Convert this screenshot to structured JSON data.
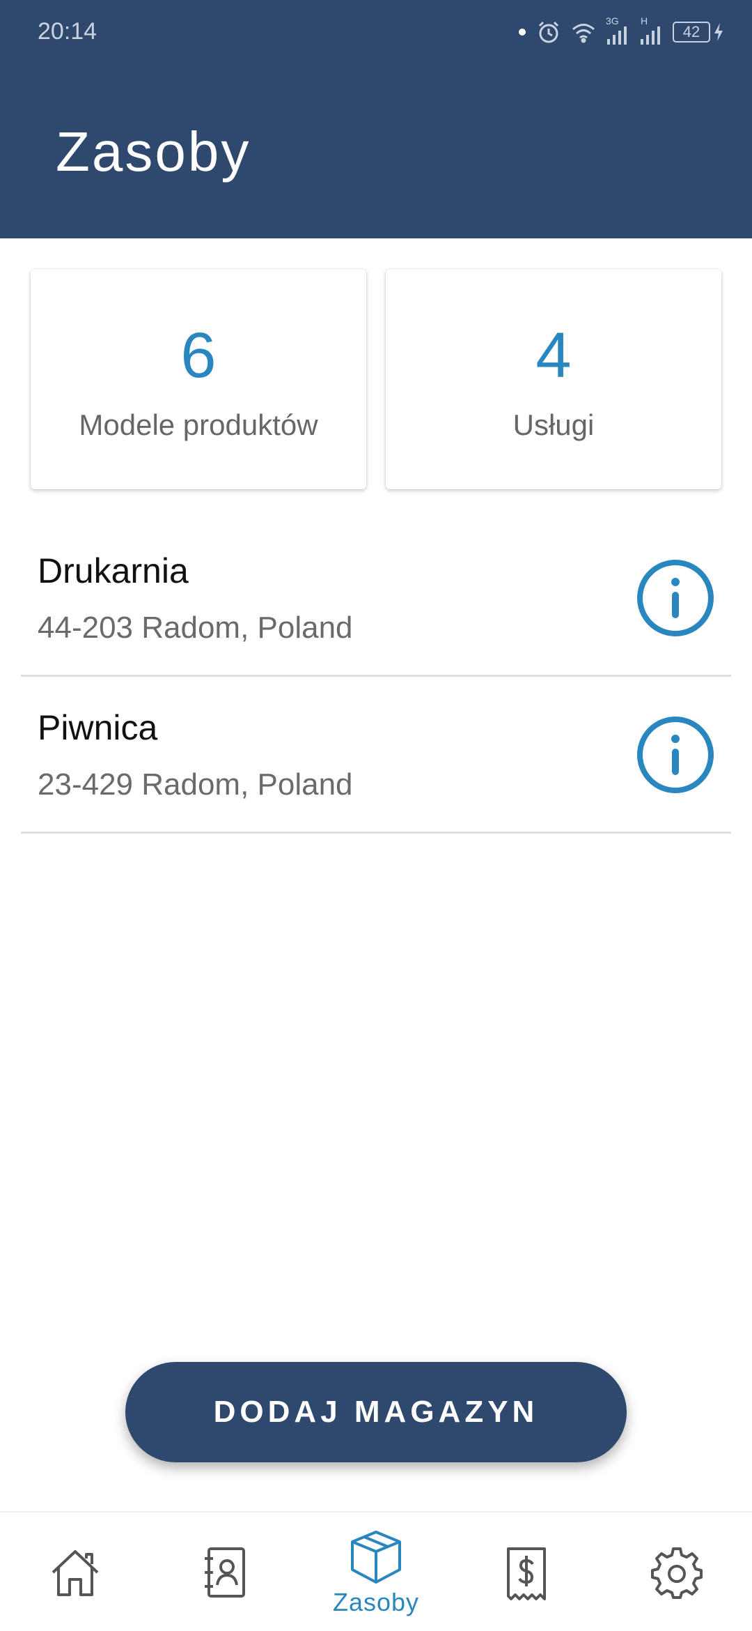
{
  "status_bar": {
    "time": "20:14",
    "network_labels": [
      "3G",
      "H"
    ],
    "battery_level": "42"
  },
  "header": {
    "title": "Zasoby"
  },
  "stats": [
    {
      "value": "6",
      "label": "Modele produktów"
    },
    {
      "value": "4",
      "label": "Usługi"
    }
  ],
  "warehouses": [
    {
      "name": "Drukarnia",
      "address": "44-203 Radom, Poland"
    },
    {
      "name": "Piwnica",
      "address": "23-429 Radom, Poland"
    }
  ],
  "primary_action": {
    "label": "DODAJ MAGAZYN"
  },
  "bottom_nav": {
    "items": [
      {
        "icon": "home-icon"
      },
      {
        "icon": "contacts-icon"
      },
      {
        "icon": "box-icon",
        "label": "Zasoby",
        "active": true
      },
      {
        "icon": "receipt-icon"
      },
      {
        "icon": "gear-icon"
      }
    ]
  },
  "colors": {
    "header_bg": "#2f496e",
    "accent": "#2a86bf",
    "nav_icon": "#555555"
  }
}
